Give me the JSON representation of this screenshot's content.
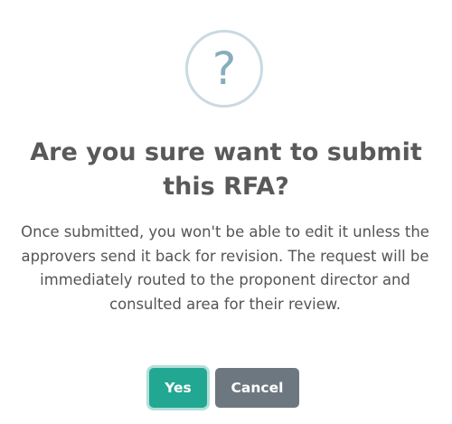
{
  "dialog": {
    "icon": {
      "name": "question-icon",
      "glyph": "?",
      "color": "#87adbd",
      "ring_color": "#c9dae1"
    },
    "title": "Are you sure want to submit this RFA?",
    "message": "Once submitted, you won't be able to edit it unless the approvers send it back for revision. The request will be immediately routed to the proponent director and consulted area for their review.",
    "buttons": {
      "confirm_label": "Yes",
      "cancel_label": "Cancel",
      "confirm_color": "#22a792",
      "cancel_color": "#6d7780"
    }
  }
}
